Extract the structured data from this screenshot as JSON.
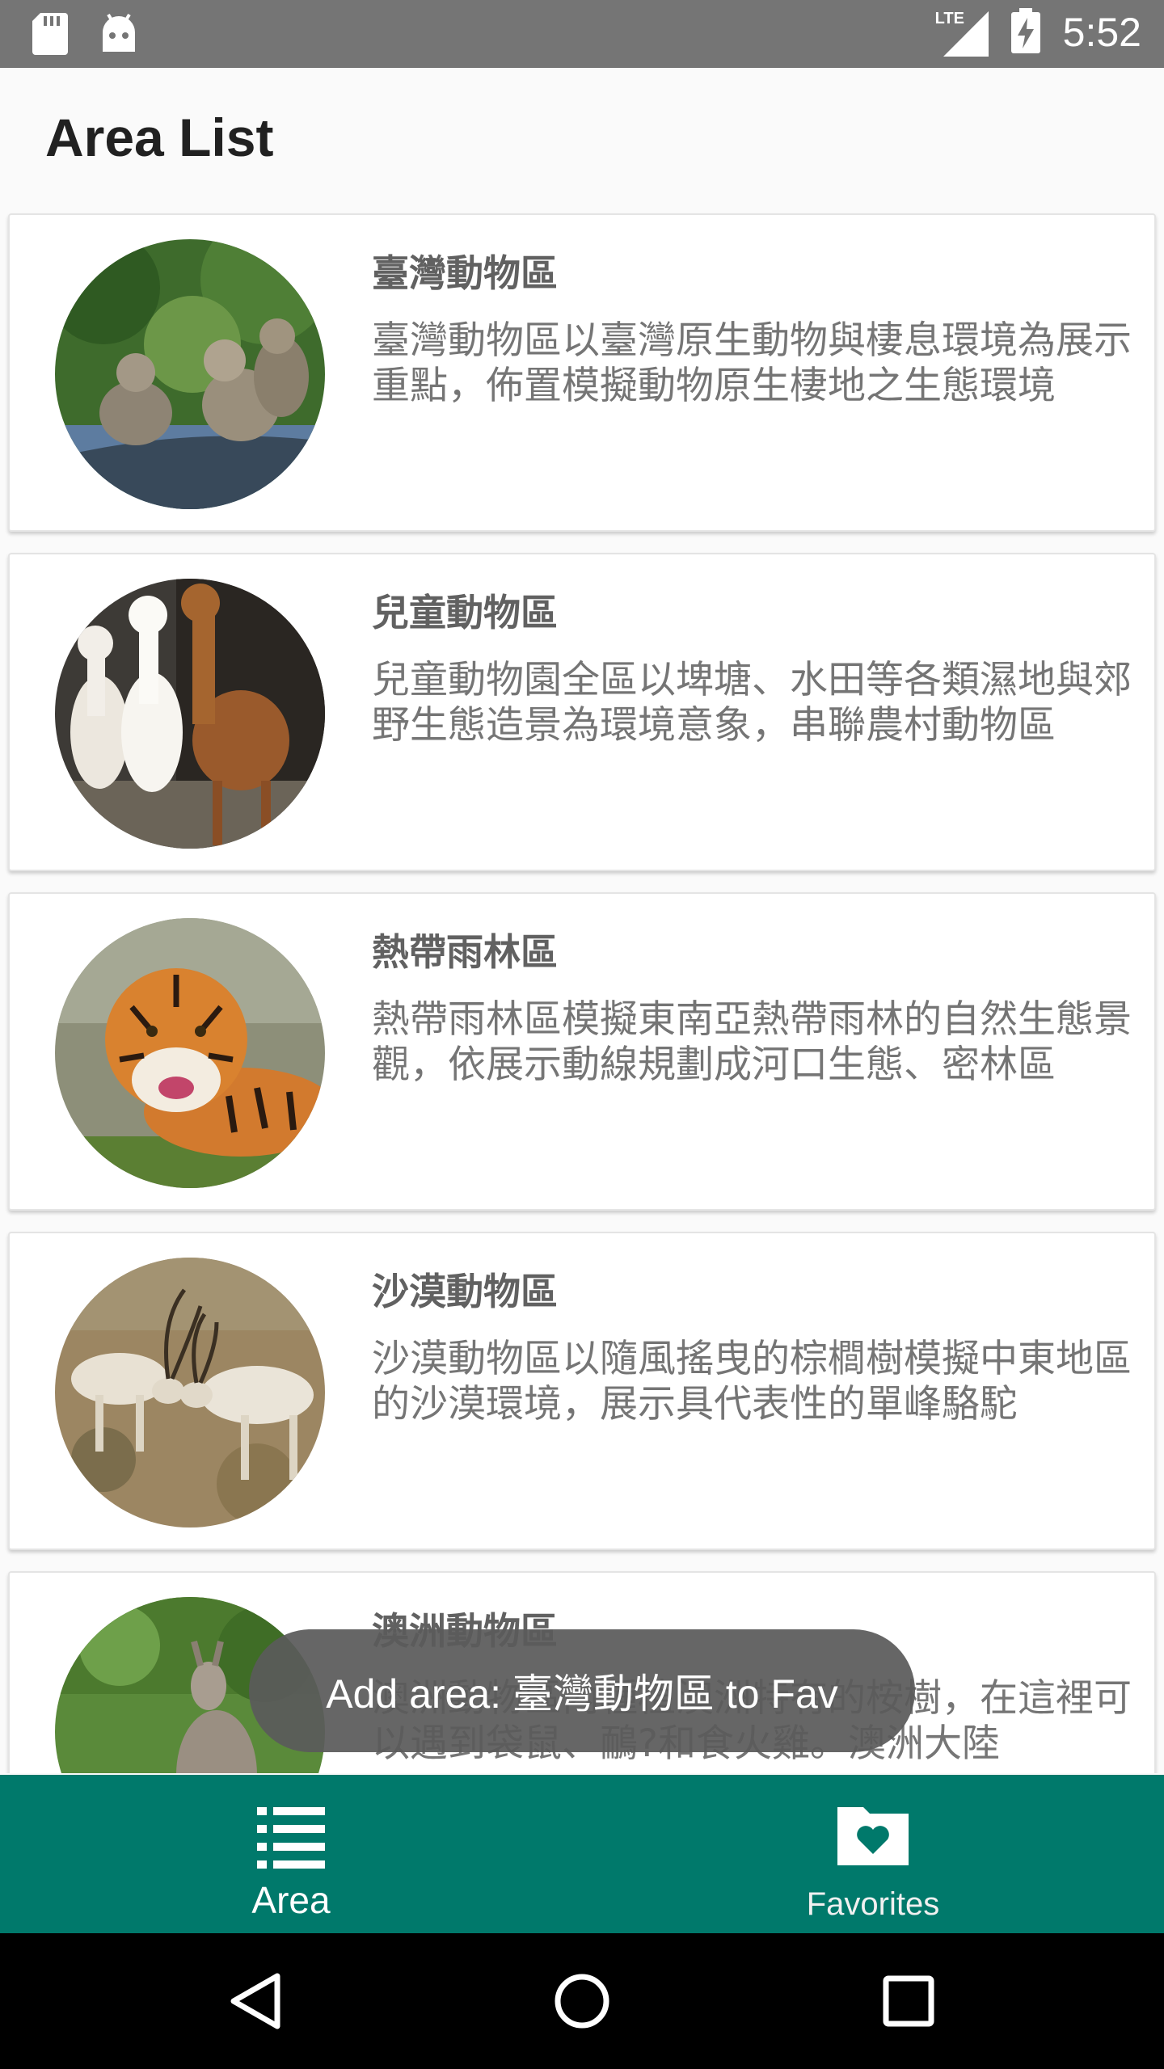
{
  "status_bar": {
    "time": "5:52",
    "network_label": "LTE"
  },
  "app_bar": {
    "title": "Area List"
  },
  "areas": [
    {
      "name": "臺灣動物區",
      "description": "臺灣動物區以臺灣原生動物與棲息環境為展示重點，佈置模擬動物原生棲地之生態環境",
      "image": "macaques"
    },
    {
      "name": "兒童動物區",
      "description": "兒童動物園全區以埤塘、水田等各類濕地與郊野生態造景為環境意象，串聯農村動物區",
      "image": "alpacas"
    },
    {
      "name": "熱帶雨林區",
      "description": "熱帶雨林區模擬東南亞熱帶雨林的自然生態景觀，依展示動線規劃成河口生態、密林區",
      "image": "tiger"
    },
    {
      "name": "沙漠動物區",
      "description": "沙漠動物區以隨風搖曳的棕櫚樹模擬中東地區的沙漠環境，展示具代表性的單峰駱駝",
      "image": "antelopes"
    },
    {
      "name": "澳洲動物區",
      "description": "澳洲動物區內種植澳洲特有的桉樹，在這裡可以遇到袋鼠、鴯?和食火雞。澳洲大陸",
      "image": "kangaroos"
    }
  ],
  "toast": {
    "message": "Add area: 臺灣動物區 to Fav"
  },
  "bottom_nav": {
    "items": [
      {
        "label": "Area",
        "icon": "list-icon",
        "active": true
      },
      {
        "label": "Favorites",
        "icon": "favorite-folder-icon",
        "active": false
      }
    ],
    "color": "#00796b"
  },
  "system_nav": {
    "buttons": [
      "back-icon",
      "home-icon",
      "recents-icon"
    ]
  }
}
